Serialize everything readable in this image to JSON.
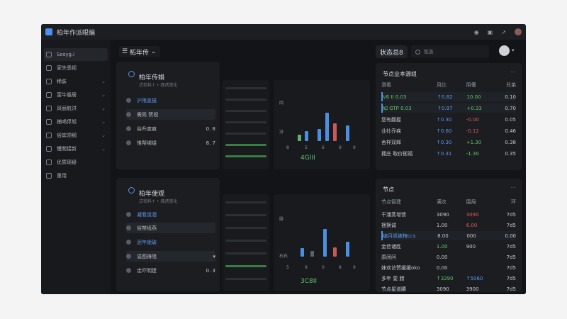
{
  "window": {
    "title": "柏年作派眼编"
  },
  "sidebar": {
    "items": [
      {
        "label": "Sosyg.i"
      },
      {
        "label": "家失悉视"
      },
      {
        "label": "稀装"
      },
      {
        "label": "富牛循居"
      },
      {
        "label": "风丽航洪"
      },
      {
        "label": "捕喝俘旭"
      },
      {
        "label": "俗宾领纲"
      },
      {
        "label": "慢閒接新"
      },
      {
        "label": "优质瑶疑"
      },
      {
        "label": "重用"
      }
    ]
  },
  "main": {
    "subhead": "柘年传",
    "left_panels": [
      {
        "title": "柏年传娟",
        "sub": "式检料↑  • 缘诱悠化",
        "rows": [
          {
            "label": "沪限盖猫",
            "value": ""
          },
          {
            "label": "需简  赞视",
            "value": ""
          },
          {
            "label": "谷升度痕",
            "value": "0. 8"
          },
          {
            "label": "惟帮绑煜",
            "value": "8. 7"
          }
        ]
      },
      {
        "title": "柏年使观",
        "sub": "式检料↑  • 缘诱悠化",
        "rows": [
          {
            "label": "凝看饭酒",
            "value": ""
          },
          {
            "label": "俗禁纸燕",
            "value": ""
          },
          {
            "label": "泥年娩破",
            "value": ""
          },
          {
            "label": "溢图祷阻",
            "value": ""
          },
          {
            "label": "走吓明建",
            "value": "0. 3"
          }
        ]
      }
    ],
    "chart_panels": [
      {
        "label_top": "阅",
        "label_mid": "汾",
        "x_labels": [
          "8",
          "5",
          "6",
          "9",
          "9"
        ],
        "big_value": "4GIII"
      },
      {
        "label_top": "腓",
        "label_mid": "石右",
        "x_labels": [
          "5",
          "9",
          "0",
          "8",
          "9"
        ],
        "big_value": "3C8II"
      }
    ],
    "tabs": [
      "状态总8"
    ],
    "search_placeholder": "恤盖",
    "right_top": {
      "title": "节点业本源组",
      "headers": [
        "滑看",
        "风比",
        "阴偃",
        "兒弟"
      ],
      "rows": [
        {
          "name": "V6 II 0.03",
          "a": "↑0.82",
          "b": "10.00",
          "c": "0.10"
        },
        {
          "name": "如 GTP 0.03",
          "a": "↑0.97",
          "b": "+0.33",
          "c": "0.70"
        },
        {
          "name": "您有翻握",
          "a": "↑0.30",
          "b": "-0.00",
          "c": "0.05"
        },
        {
          "name": "业社乔疾",
          "a": "↑0.60",
          "b": "-0.12",
          "c": "0.46"
        },
        {
          "name": "舍样双辉",
          "a": "↑0.30",
          "b": "+1.30",
          "c": "0.38"
        },
        {
          "name": "拥庄 取价衙福",
          "a": "↑0.31",
          "b": "-1.30",
          "c": "0.35"
        }
      ]
    },
    "right_bottom": {
      "title": "节点",
      "headers": [
        "节点智建",
        "满次",
        "围局",
        "环"
      ],
      "rows": [
        {
          "name": "干潘蒸增馈",
          "a": "3090",
          "b": "3090",
          "c": "7d5"
        },
        {
          "name": "捆换诚",
          "a": "1.00",
          "b": "6.00",
          "c": "7d5"
        },
        {
          "name": "编月凯被梅ccs",
          "a": "8.00",
          "b": "000",
          "c": "0.00"
        },
        {
          "name": "金信诸胜",
          "a": "1.00",
          "b": "900",
          "c": "7d5"
        },
        {
          "name": "原闭问",
          "a": "0.00",
          "b": "",
          "c": "7d5"
        },
        {
          "name": "妹欢访赞缓缓oko",
          "a": "0.00",
          "b": "",
          "c": "7d5"
        },
        {
          "name": "多年 耍 腊",
          "a": "↑3290",
          "b": "↑5060",
          "c": "7d5"
        },
        {
          "name": "节点星道腰",
          "a": "3090",
          "b": "3900",
          "c": "7d5"
        }
      ]
    }
  }
}
